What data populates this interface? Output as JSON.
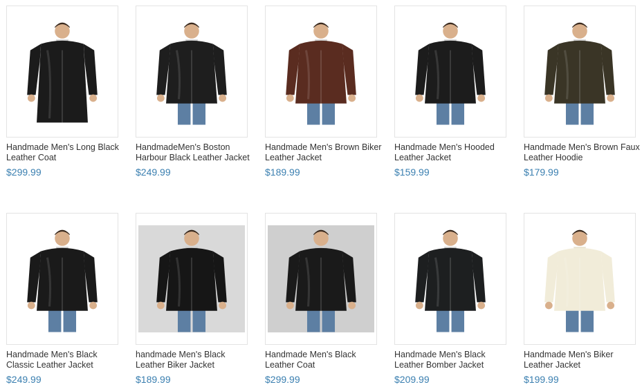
{
  "products": [
    {
      "title": "Handmade Men's Long Black Leather Coat",
      "price": "$299.99",
      "image_icon": "long-black-leather-coat-photo",
      "coat_color": "#1b1b1b",
      "bg": "white"
    },
    {
      "title": "HandmadeMen's Boston Harbour Black Leather Jacket",
      "price": "$249.99",
      "image_icon": "black-leather-jacket-photo",
      "coat_color": "#1e1e1e",
      "bg": "white"
    },
    {
      "title": "Handmade Men's Brown Biker Leather Jacket",
      "price": "$189.99",
      "image_icon": "brown-biker-jacket-photo",
      "coat_color": "#5a2c20",
      "bg": "white"
    },
    {
      "title": "Handmade Men's Hooded Leather Jacket",
      "price": "$159.99",
      "image_icon": "hooded-leather-jacket-photo",
      "coat_color": "#1c1c1c",
      "bg": "white"
    },
    {
      "title": "Handmade Men's Brown Faux Leather Hoodie",
      "price": "$179.99",
      "image_icon": "brown-faux-hoodie-photo",
      "coat_color": "#3a3526",
      "bg": "white"
    },
    {
      "title": "Handmade Men's Black Classic Leather Jacket",
      "price": "$249.99",
      "image_icon": "classic-leather-jacket-photo",
      "coat_color": "#1a1a1a",
      "bg": "white"
    },
    {
      "title": "handmade Men's Black Leather Biker Jacket",
      "price": "$189.99",
      "image_icon": "black-biker-jacket-photo",
      "coat_color": "#161616",
      "bg": "gray"
    },
    {
      "title": "Handmade Men's Black Leather Coat",
      "price": "$299.99",
      "image_icon": "black-leather-coat-photo",
      "coat_color": "#1a1a1a",
      "bg": "gray2"
    },
    {
      "title": "Handmade Men's Black Leather Bomber Jacket",
      "price": "$209.99",
      "image_icon": "bomber-jacket-photo",
      "coat_color": "#1d1f20",
      "bg": "white"
    },
    {
      "title": "Handmade Men's Biker Leather Jacket",
      "price": "$199.99",
      "image_icon": "cream-biker-jacket-photo",
      "coat_color": "#f1ecd9",
      "bg": "white"
    }
  ]
}
